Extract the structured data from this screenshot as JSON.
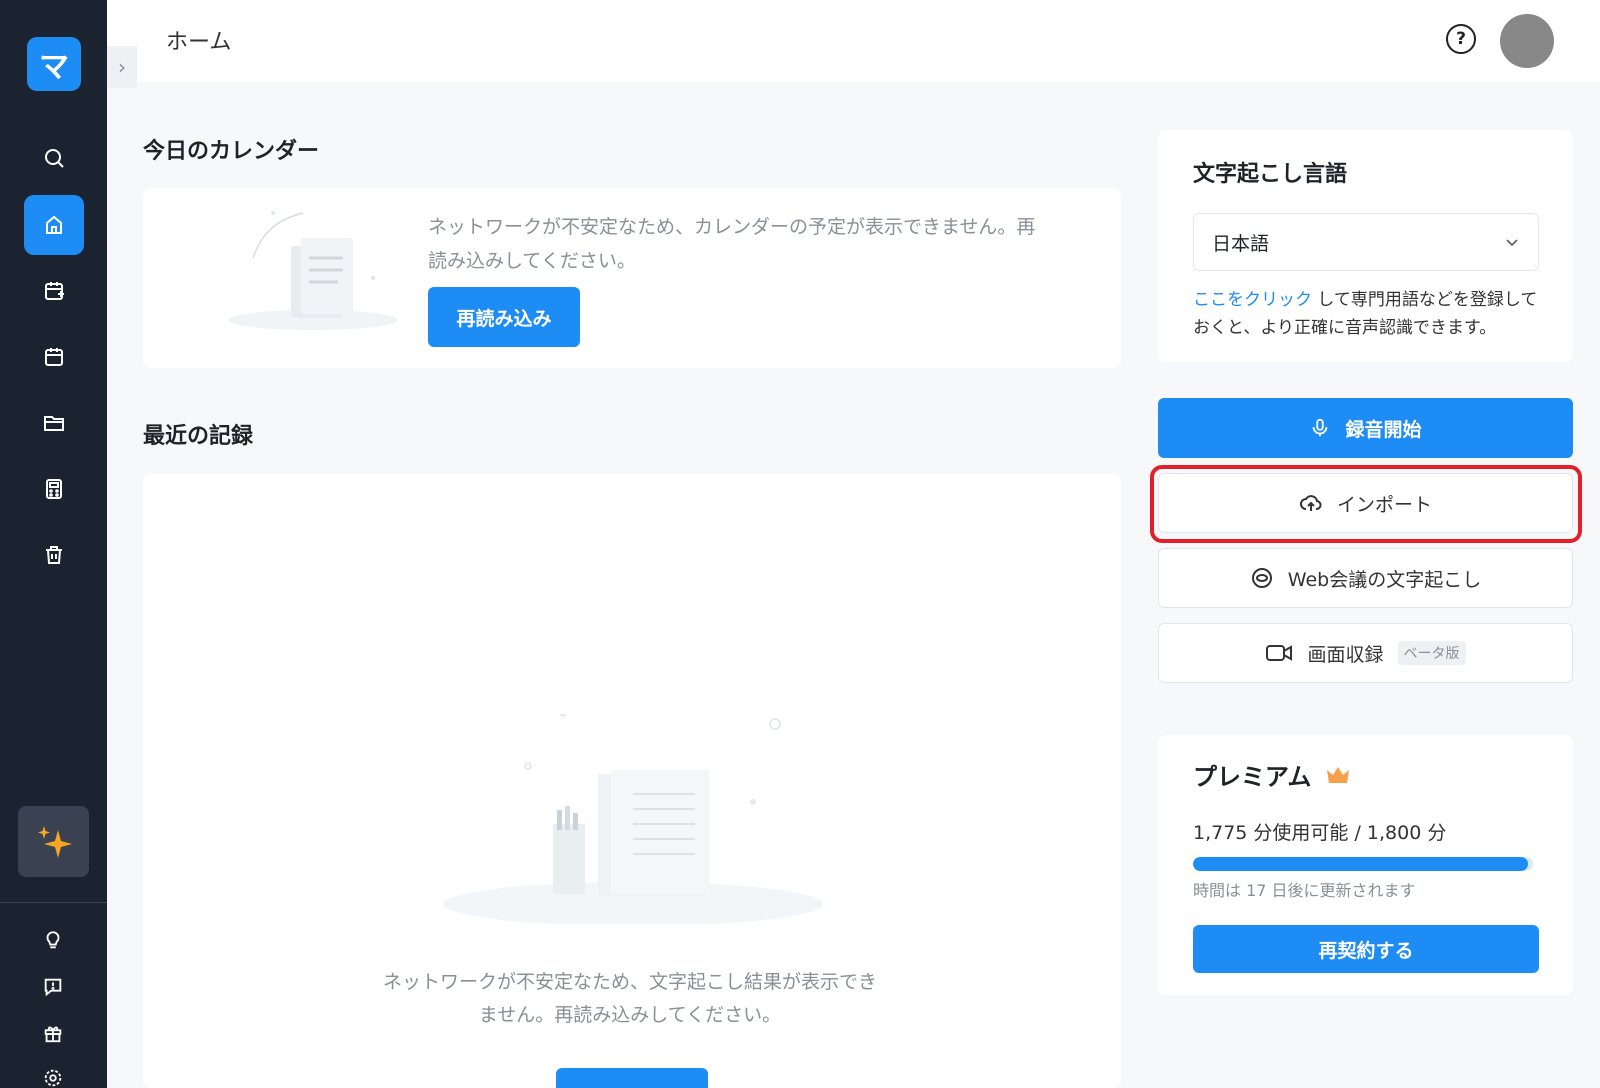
{
  "app": {
    "logo_glyph": "マ",
    "brand_color": "#1e8cf5"
  },
  "header": {
    "title": "ホーム"
  },
  "calendar": {
    "heading": "今日のカレンダー",
    "message": "ネットワークが不安定なため、カレンダーの予定が表示できません。再読み込みしてください。",
    "reload_label": "再読み込み"
  },
  "recent": {
    "heading": "最近の記録",
    "message": "ネットワークが不安定なため、文字起こし結果が表示できません。再読み込みしてください。"
  },
  "language": {
    "heading": "文字起こし言語",
    "selected": "日本語",
    "note_link": "ここをクリック",
    "note_text": "して専門用語などを登録しておくと、より正確に音声認識できます。"
  },
  "actions": {
    "record": "録音開始",
    "import": "インポート",
    "web_meeting": "Web会議の文字起こし",
    "screen_record": "画面収録",
    "beta": "ベータ版"
  },
  "premium": {
    "heading": "プレミアム",
    "usage": "1,775 分使用可能 / 1,800 分",
    "usage_fraction": 0.986,
    "renew_note": "時間は 17 日後に更新されます",
    "renew_label": "再契約する"
  },
  "icons": [
    "search-icon",
    "home-icon",
    "calendar-add-icon",
    "calendar-icon",
    "folder-icon",
    "calculator-icon",
    "trash-icon",
    "sparkle-icon",
    "lightbulb-icon",
    "feedback-icon",
    "gift-icon",
    "settings-icon",
    "help-icon",
    "mic-icon",
    "cloud-upload-icon",
    "meeting-icon",
    "video-icon",
    "crown-icon",
    "chevron-down-icon",
    "chevron-right-icon"
  ]
}
